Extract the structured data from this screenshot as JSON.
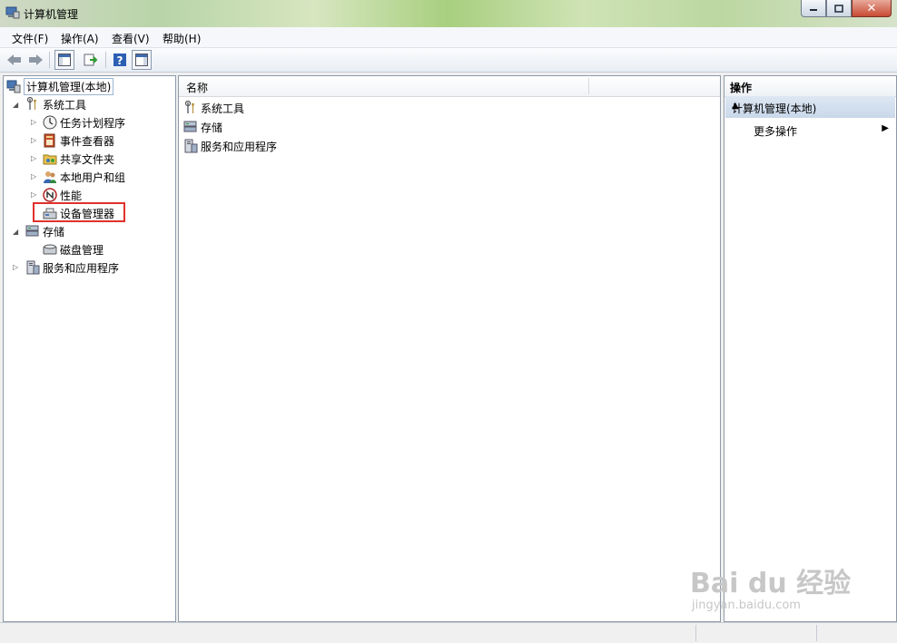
{
  "window": {
    "title": "计算机管理"
  },
  "menu": [
    "文件(F)",
    "操作(A)",
    "查看(V)",
    "帮助(H)"
  ],
  "tree": {
    "root": "计算机管理(本地)",
    "system_tools": "系统工具",
    "task_scheduler": "任务计划程序",
    "event_viewer": "事件查看器",
    "shared_folders": "共享文件夹",
    "local_users": "本地用户和组",
    "performance": "性能",
    "device_manager": "设备管理器",
    "storage": "存储",
    "disk_management": "磁盘管理",
    "services_apps": "服务和应用程序"
  },
  "center": {
    "column_name": "名称",
    "items": [
      "系统工具",
      "存储",
      "服务和应用程序"
    ]
  },
  "actions": {
    "header": "操作",
    "group": "计算机管理(本地)",
    "more": "更多操作"
  },
  "watermark": {
    "brand": "Bai du 经验",
    "url": "jingyan.baidu.com"
  },
  "colors": {
    "highlight": "#e0312b",
    "selection_border": "#99b4d1"
  }
}
